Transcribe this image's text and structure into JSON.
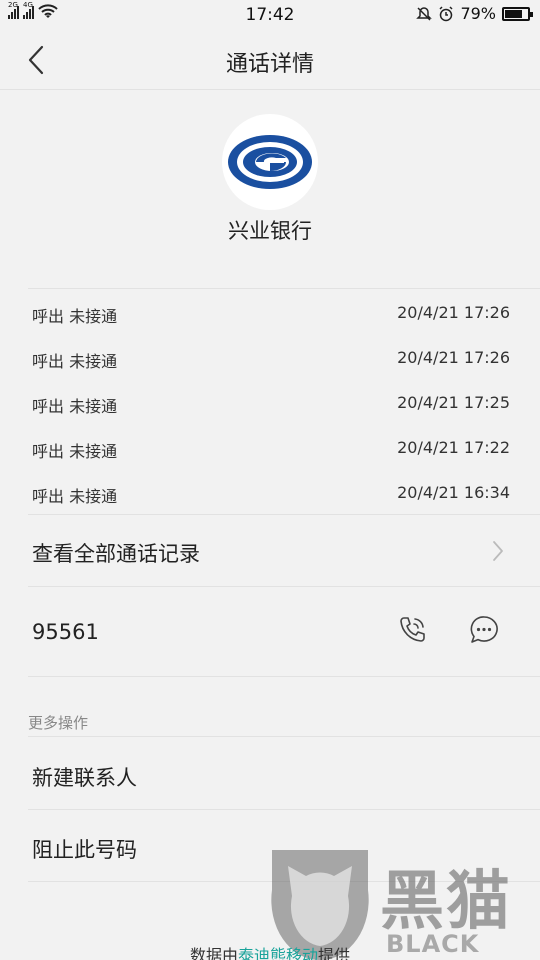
{
  "status_bar": {
    "network_1": "2G",
    "network_2": "4G",
    "time": "17:42",
    "battery": "79%",
    "battery_level": 0.79
  },
  "header": {
    "title": "通话详情"
  },
  "contact": {
    "name": "兴业银行",
    "avatar_color": "#1a4fa0"
  },
  "call_log": [
    {
      "type": "呼出  未接通",
      "time": "20/4/21 17:26"
    },
    {
      "type": "呼出  未接通",
      "time": "20/4/21 17:26"
    },
    {
      "type": "呼出  未接通",
      "time": "20/4/21 17:25"
    },
    {
      "type": "呼出  未接通",
      "time": "20/4/21 17:22"
    },
    {
      "type": "呼出  未接通",
      "time": "20/4/21 16:34"
    }
  ],
  "view_all": {
    "label": "查看全部通话记录"
  },
  "number": {
    "value": "95561"
  },
  "more_actions": {
    "header": "更多操作",
    "new_contact": "新建联系人",
    "block_number": "阻止此号码"
  },
  "watermark": {
    "cn": "黑猫",
    "en": "BLACK CAT"
  },
  "footer": {
    "prefix": "数据由",
    "provider": "泰迪熊移动",
    "suffix": "提供"
  }
}
